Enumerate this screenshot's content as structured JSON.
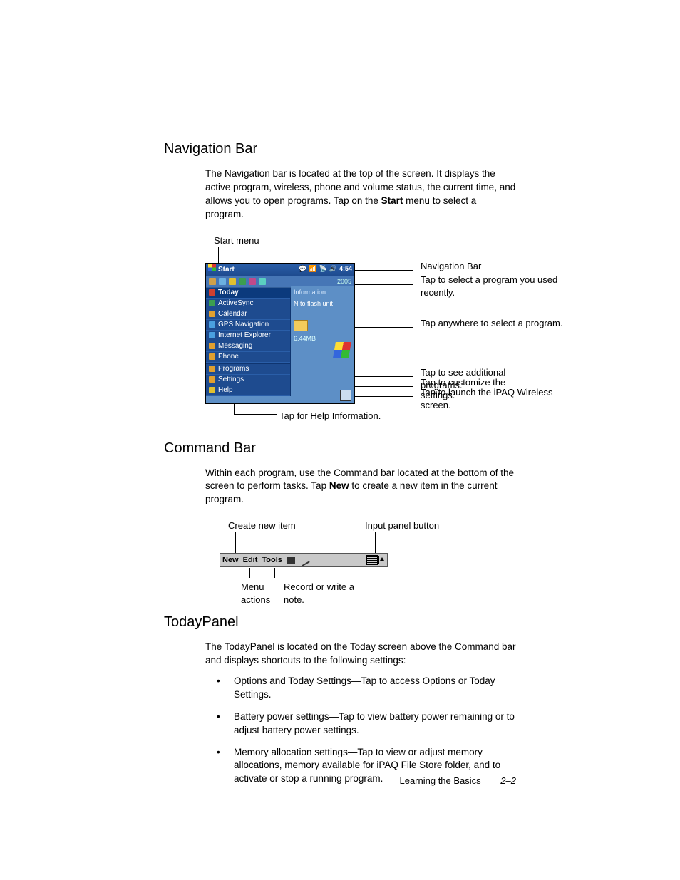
{
  "section1": {
    "heading": "Navigation Bar",
    "para_a": "The Navigation bar is located at the top of the screen. It displays the active program, wireless, phone and volume status, the current time, and allows you to open programs. Tap on the ",
    "para_bold": "Start",
    "para_b": " menu to select a program."
  },
  "navdiag": {
    "start_label": "Start menu",
    "pda": {
      "start": "Start",
      "time": "4:54",
      "year": "2005",
      "info": "Information",
      "flash": "N to flash unit",
      "mb": "6.44MB",
      "items": {
        "today": "Today",
        "activesync": "ActiveSync",
        "calendar": "Calendar",
        "gps": "GPS Navigation",
        "ie": "Internet Explorer",
        "messaging": "Messaging",
        "phone": "Phone",
        "programs": "Programs",
        "settings": "Settings",
        "help": "Help"
      }
    },
    "callouts": {
      "navbar": "Navigation Bar",
      "recent": "Tap to select a program you used recently.",
      "any": "Tap anywhere to select a program.",
      "programs": "Tap to see additional programs.",
      "settings": "Tap to customize the settings.",
      "wireless": "Tap to launch the iPAQ Wireless screen.",
      "help": "Tap for Help Information."
    }
  },
  "section2": {
    "heading": "Command Bar",
    "para_a": "Within each program, use the Command bar located at the bottom of the screen to perform tasks. Tap ",
    "para_bold": "New",
    "para_b": " to create a new item in the current program."
  },
  "cmddiag": {
    "create": "Create new item",
    "input": "Input panel button",
    "menu": "Menu actions",
    "record": "Record or write a note.",
    "bar": {
      "new": "New",
      "edit": "Edit",
      "tools": "Tools"
    }
  },
  "section3": {
    "heading": "TodayPanel",
    "para": "The TodayPanel is located on the Today screen above the Command bar and displays shortcuts to the following settings:",
    "bullets": [
      "Options and Today Settings—Tap to access Options or Today Settings.",
      "Battery power settings—Tap to view battery power remaining or to adjust battery power settings.",
      "Memory allocation settings—Tap to view or adjust memory allocations, memory available for iPAQ File Store folder, and to activate or stop a running program."
    ]
  },
  "footer": {
    "chapter": "Learning the Basics",
    "page": "2–2"
  }
}
